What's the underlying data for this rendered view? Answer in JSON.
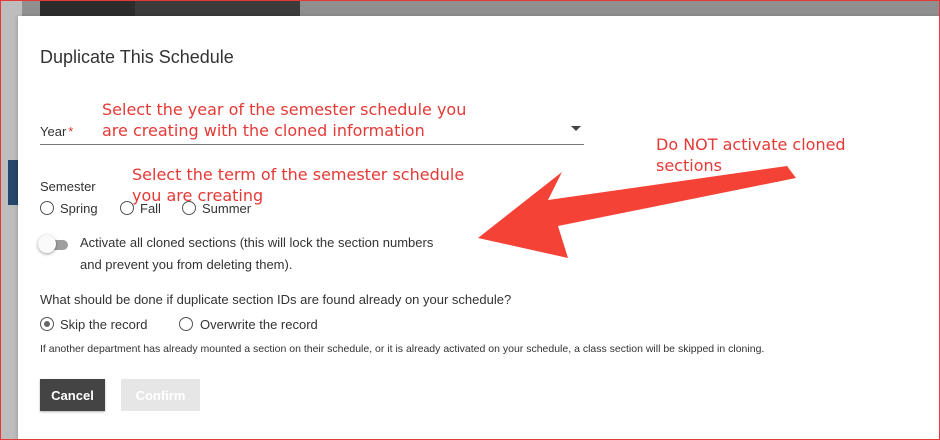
{
  "modal": {
    "title": "Duplicate This Schedule",
    "year": {
      "label": "Year",
      "required_mark": "*",
      "value": ""
    },
    "semester": {
      "label": "Semester",
      "options": [
        "Spring",
        "Fall",
        "Summer"
      ],
      "selected": null
    },
    "activate_toggle": {
      "label_line1": "Activate all cloned sections (this will lock the section numbers",
      "label_line2": "and prevent you from deleting them).",
      "on": false
    },
    "duplicate_question": "What should be done if duplicate section IDs are found already on your schedule?",
    "duplicate_options": [
      "Skip the record",
      "Overwrite the record"
    ],
    "duplicate_selected": "Skip the record",
    "note": "If another department has already mounted a section on their schedule, or it is already activated on your schedule, a class section will be skipped in cloning.",
    "buttons": {
      "cancel": "Cancel",
      "confirm": "Confirm"
    }
  },
  "annotations": {
    "year_line1": "Select the year of the semester schedule you",
    "year_line2": "are creating with the cloned information",
    "term_line1": "Select the term of the semester schedule",
    "term_line2": "you are creating",
    "activate_line1": "Do NOT activate cloned",
    "activate_line2": "sections"
  },
  "colors": {
    "annotation": "#e53935",
    "cancel_bg": "#444444",
    "confirm_disabled": "#e6e6e6"
  }
}
